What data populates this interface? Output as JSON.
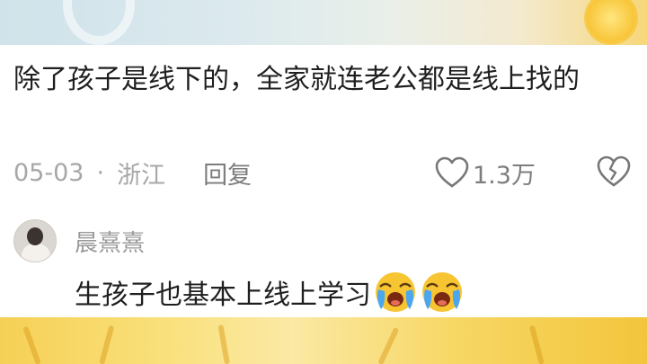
{
  "comment": {
    "text": "除了孩子是线下的，全家就连老公都是线上找的",
    "date": "05-03",
    "separator": "·",
    "location": "浙江",
    "reply_label": "回复",
    "like_count": "1.3万"
  },
  "reply": {
    "username": "晨熹熹",
    "text": "生孩子也基本上线上学习",
    "emojis": [
      "loudly-crying-face-emoji",
      "loudly-crying-face-emoji"
    ]
  },
  "icons": {
    "like": "heart-outline-icon",
    "dislike": "broken-heart-icon"
  },
  "colors": {
    "text_primary": "#1f1f1f",
    "text_meta": "#a7a7a7",
    "emoji_yellow": "#f7c531",
    "tear_blue": "#4aa6f0"
  }
}
